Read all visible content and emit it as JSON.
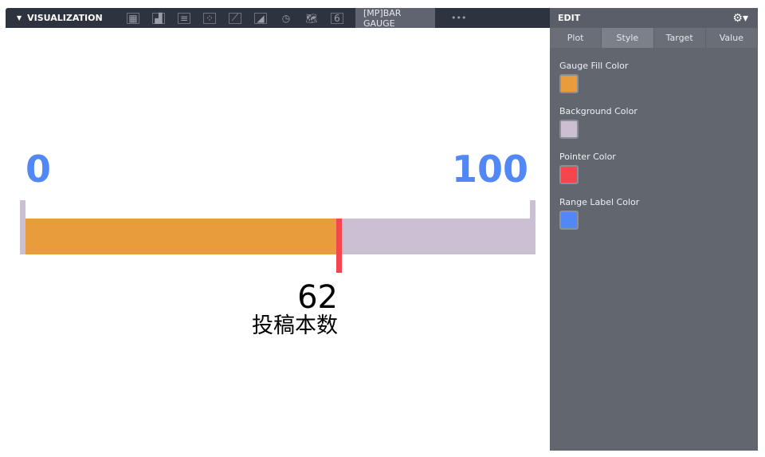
{
  "toolbar": {
    "title": "VISUALIZATION",
    "icons": [
      "table-icon",
      "column-chart-icon",
      "bar-chart-icon",
      "scatter-icon",
      "line-chart-icon",
      "area-chart-icon",
      "pie-chart-icon",
      "map-icon",
      "single-value-icon"
    ],
    "single_value_glyph": "6",
    "active_tab": "[MP]BAR GAUGE",
    "more": "•••"
  },
  "panel": {
    "title": "EDIT",
    "tabs": [
      "Plot",
      "Style",
      "Target",
      "Value"
    ],
    "active_tab": "Style",
    "fields": [
      {
        "label": "Gauge Fill Color",
        "color": "#e89c3b"
      },
      {
        "label": "Background Color",
        "color": "#cbbfd3"
      },
      {
        "label": "Pointer Color",
        "color": "#f5464f"
      },
      {
        "label": "Range Label Color",
        "color": "#5188f5"
      }
    ]
  },
  "gauge": {
    "min": "0",
    "max": "100",
    "value": 62,
    "value_text": "62",
    "label": "投稿本数"
  }
}
